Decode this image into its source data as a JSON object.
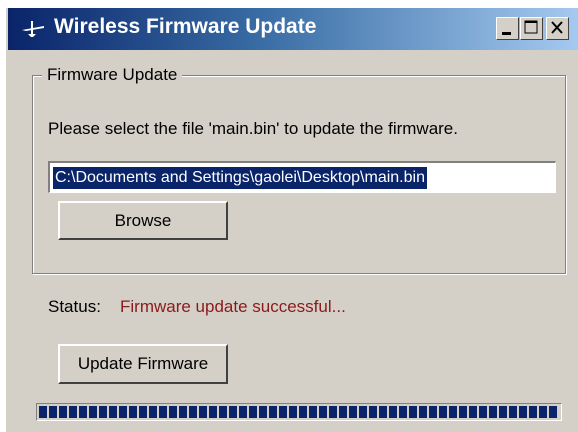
{
  "window": {
    "title": "Wireless Firmware Update",
    "icons": {
      "app": "app-icon",
      "minimize": "minimize-icon",
      "maximize": "maximize-icon",
      "close": "close-icon"
    }
  },
  "group": {
    "legend": "Firmware Update",
    "instruction": "Please select the file 'main.bin' to update the firmware.",
    "file_path": "C:\\Documents and Settings\\gaolei\\Desktop\\main.bin",
    "browse_label": "Browse"
  },
  "status": {
    "label": "Status:",
    "value": "Firmware update successful..."
  },
  "update_button_label": "Update Firmware",
  "progress": {
    "fraction": 1.0
  },
  "colors": {
    "title_gradient_start": "#0a246a",
    "title_gradient_end": "#a6caf0",
    "window_face": "#d4d0c8",
    "selection": "#0a246a",
    "status_text": "#8b1a1a",
    "progress_block": "#0a246a"
  }
}
